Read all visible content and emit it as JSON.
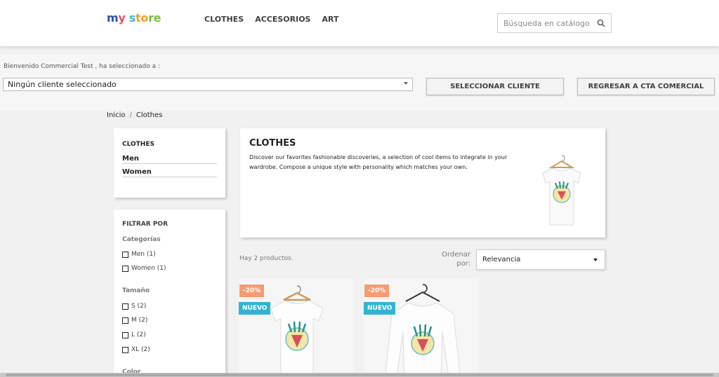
{
  "header": {
    "logo": [
      "m",
      "y ",
      "s",
      "to",
      "re"
    ],
    "nav": [
      "CLOTHES",
      "ACCESORIOS",
      "ART"
    ],
    "search_placeholder": "Búsqueda en catálogo"
  },
  "commercial": {
    "welcome": "Bienvenido Commercial Test , ha seleccionado a :",
    "selected_client": "Ningún cliente seleccionado",
    "select_button": "SELECCIONAR CLIENTE",
    "return_button": "REGRESAR A CTA COMERCIAL"
  },
  "breadcrumb": {
    "home": "Inicio",
    "separator": "/",
    "current": "Clothes"
  },
  "sidebar": {
    "category_title": "CLOTHES",
    "subcategories": [
      "Men",
      "Women"
    ],
    "filter_title": "FILTRAR POR",
    "facets": [
      {
        "label": "Categorías",
        "options": [
          "Men (1)",
          "Women (1)"
        ]
      },
      {
        "label": "Tamaño",
        "options": [
          "S (2)",
          "M (2)",
          "L (2)",
          "XL (2)"
        ]
      },
      {
        "label": "Color",
        "options": []
      }
    ]
  },
  "category": {
    "title": "CLOTHES",
    "description": "Discover our favorites fashionable discoveries, a selection of cool items to integrate in your wardrobe. Compose a unique style with personality which matches your own."
  },
  "listing": {
    "count": "Hay 2 productos.",
    "sort_label": "Ordenar por:",
    "sort_value": "Relevancia"
  },
  "products": [
    {
      "discount": "-20%",
      "flag": "NUEVO"
    },
    {
      "discount": "-20%",
      "flag": "NUEVO"
    }
  ],
  "colors": {
    "discount_badge": "#f39d72",
    "new_badge": "#2fb5d2",
    "background": "#f1f1f1"
  }
}
